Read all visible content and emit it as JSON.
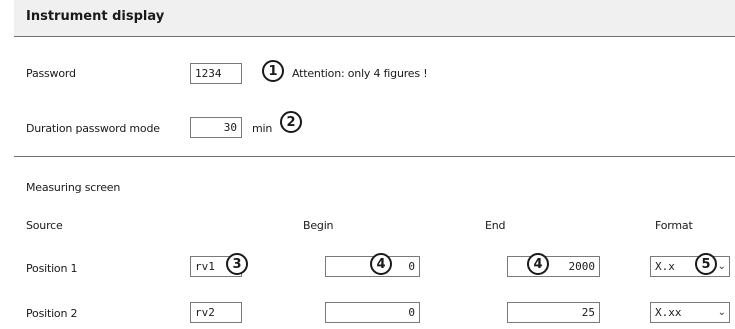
{
  "header": {
    "title": "Instrument display"
  },
  "password": {
    "label": "Password",
    "value": "1234",
    "callout": "1",
    "attention": "Attention: only 4 figures !"
  },
  "duration": {
    "label": "Duration password mode",
    "value": "30",
    "unit": "min",
    "callout": "2"
  },
  "measuring": {
    "section_label": "Measuring screen",
    "columns": {
      "source": "Source",
      "begin": "Begin",
      "end": "End",
      "format": "Format"
    },
    "rows": [
      {
        "label": "Position 1",
        "source": "rv1",
        "begin": "0",
        "end": "2000",
        "format": "X.x",
        "callout_source": "3",
        "callout_begin": "4",
        "callout_end": "4",
        "callout_format": "5"
      },
      {
        "label": "Position 2",
        "source": "rv2",
        "begin": "0",
        "end": "25",
        "format": "X.xx"
      }
    ]
  },
  "icons": {
    "dropdown": "chevron-down-icon",
    "callout": "circled-number-icon"
  }
}
